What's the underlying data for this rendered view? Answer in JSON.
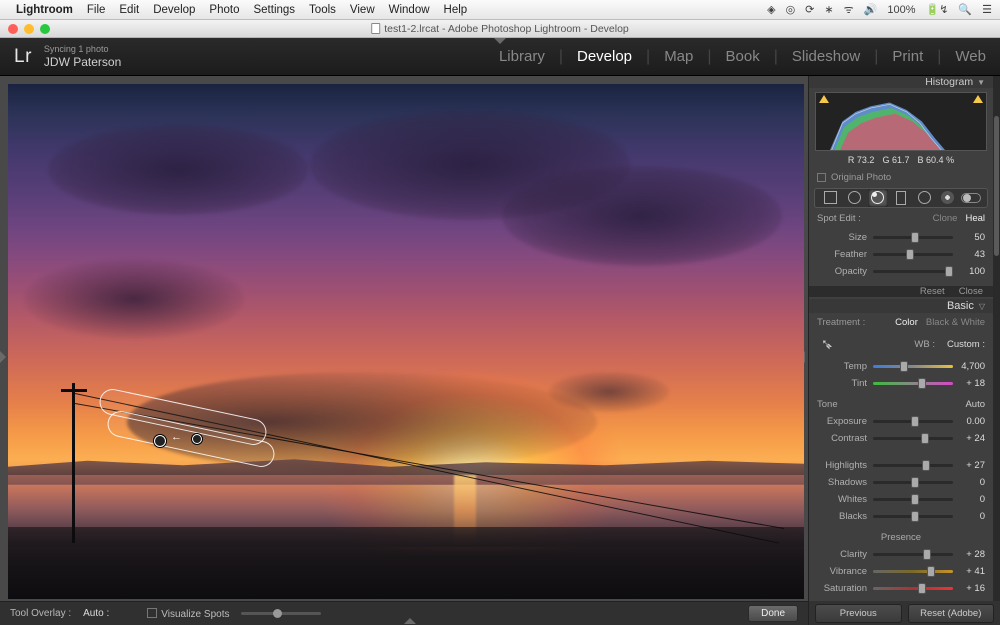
{
  "mac_menu": {
    "app": "Lightroom",
    "items": [
      "File",
      "Edit",
      "Develop",
      "Photo",
      "Settings",
      "Tools",
      "View",
      "Window",
      "Help"
    ],
    "battery": "100%",
    "status_icons": [
      "shield-icon",
      "eye-alt-icon",
      "sync-icon",
      "bluetooth-icon",
      "wifi-icon",
      "volume-icon"
    ],
    "battery_icon": "battery-charging-icon",
    "right_icons": [
      "spotlight-icon",
      "control-center-icon"
    ]
  },
  "window": {
    "title": "test1-2.lrcat - Adobe Photoshop Lightroom - Develop"
  },
  "identity": {
    "sync": "Syncing 1 photo",
    "name": "JDW Paterson",
    "logo": "Lr"
  },
  "modules": [
    "Library",
    "Develop",
    "Map",
    "Book",
    "Slideshow",
    "Print",
    "Web"
  ],
  "active_module": "Develop",
  "toolbar": {
    "overlay_label": "Tool Overlay :",
    "overlay_value": "Auto  :",
    "vis_label": "Visualize Spots",
    "done": "Done"
  },
  "rpanel": {
    "histogram_label": "Histogram",
    "rgb": {
      "r_label": "R",
      "r": "73.2",
      "g_label": "G",
      "g": "61.7",
      "b_label": "B",
      "b": "60.4",
      "pct": "%"
    },
    "original_photo": "Original Photo",
    "spot": {
      "label": "Spot Edit :",
      "clone": "Clone",
      "heal": "Heal",
      "size_label": "Size",
      "size": "50",
      "feather_label": "Feather",
      "feather": "43",
      "opacity_label": "Opacity",
      "opacity": "100",
      "reset": "Reset",
      "close": "Close"
    },
    "basic": {
      "title": "Basic",
      "treatment_label": "Treatment :",
      "color": "Color",
      "bw": "Black & White",
      "wb_label": "WB :",
      "wb_value": "Custom  :",
      "temp_label": "Temp",
      "temp": "4,700",
      "tint_label": "Tint",
      "tint": "+ 18",
      "tone_label": "Tone",
      "auto": "Auto",
      "exposure_label": "Exposure",
      "exposure": "0.00",
      "contrast_label": "Contrast",
      "contrast": "+ 24",
      "highlights_label": "Highlights",
      "highlights": "+ 27",
      "shadows_label": "Shadows",
      "shadows": "0",
      "whites_label": "Whites",
      "whites": "0",
      "blacks_label": "Blacks",
      "blacks": "0",
      "presence_label": "Presence",
      "clarity_label": "Clarity",
      "clarity": "+ 28",
      "vibrance_label": "Vibrance",
      "vibrance": "+ 41",
      "saturation_label": "Saturation",
      "saturation": "+ 16"
    },
    "footer": {
      "previous": "Previous",
      "reset": "Reset (Adobe)"
    }
  }
}
